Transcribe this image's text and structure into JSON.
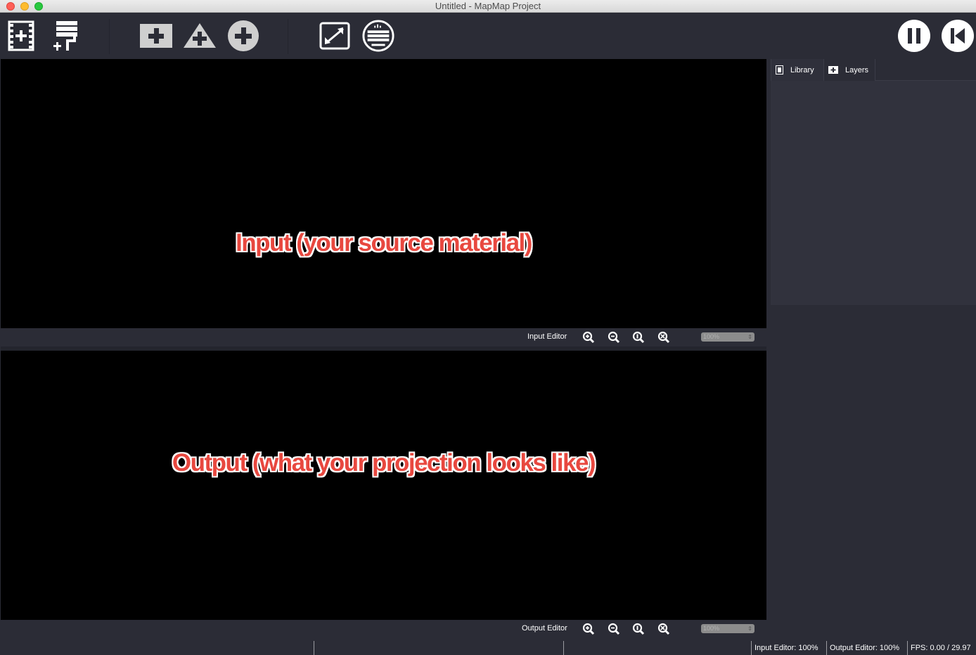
{
  "window": {
    "title": "Untitled - MapMap Project"
  },
  "toolbar": {
    "buttons": [
      {
        "name": "add-video-button",
        "icon": "film-plus-icon"
      },
      {
        "name": "add-color-button",
        "icon": "paint-roller-plus-icon"
      },
      {
        "name": "add-quad-button",
        "icon": "square-plus-icon"
      },
      {
        "name": "add-triangle-button",
        "icon": "triangle-plus-icon"
      },
      {
        "name": "add-ellipse-button",
        "icon": "circle-plus-icon"
      },
      {
        "name": "fullscreen-button",
        "icon": "fullscreen-icon"
      },
      {
        "name": "console-button",
        "icon": "keyboard-icon"
      },
      {
        "name": "pause-button",
        "icon": "pause-icon"
      },
      {
        "name": "rewind-button",
        "icon": "skip-back-icon"
      }
    ]
  },
  "input_editor": {
    "overlay": "Input (your source material)",
    "label": "Input Editor",
    "zoom_value": "100%"
  },
  "output_editor": {
    "overlay": "Output (what your projection looks like)",
    "label": "Output Editor",
    "zoom_value": "100%"
  },
  "right_panel": {
    "tabs": [
      {
        "label": "Library",
        "icon": "film-icon"
      },
      {
        "label": "Layers",
        "icon": "layers-plus-icon"
      }
    ]
  },
  "status": {
    "input_zoom": "Input Editor: 100%",
    "output_zoom": "Output Editor: 100%",
    "fps": "FPS: 0.00 / 29.97"
  },
  "colors": {
    "background": "#2b2c36",
    "canvas": "#000000",
    "overlay_text": "#e8483f"
  }
}
